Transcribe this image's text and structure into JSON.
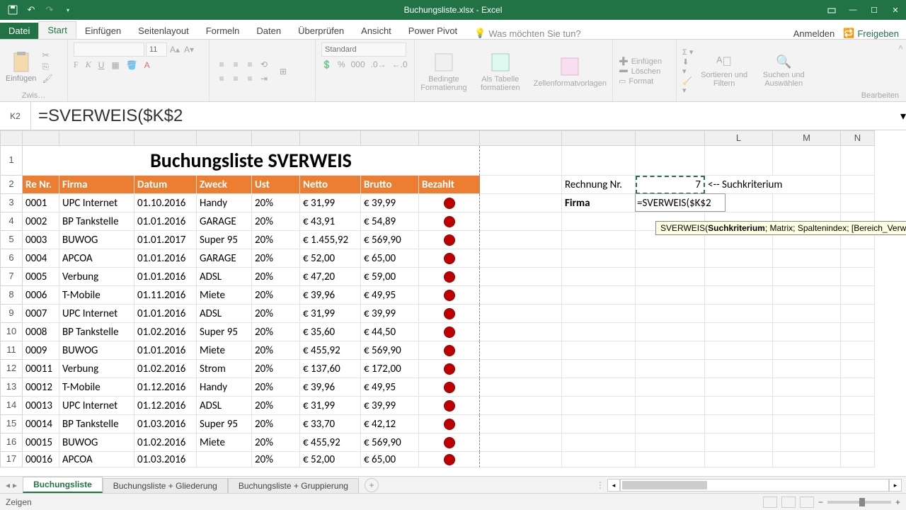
{
  "title": "Buchungsliste.xlsx - Excel",
  "tabs": {
    "file": "Datei",
    "start": "Start",
    "einfuegen": "Einfügen",
    "seitenlayout": "Seitenlayout",
    "formeln": "Formeln",
    "daten": "Daten",
    "ueberpruefen": "Überprüfen",
    "ansicht": "Ansicht",
    "powerpivot": "Power Pivot"
  },
  "tellme": "Was möchten Sie tun?",
  "login": "Anmelden",
  "share": "Freigeben",
  "ribbon": {
    "einfuegen": "Einfügen",
    "clipboard_label": "Zwis…",
    "font_size": "11",
    "number_format": "Standard",
    "bedingte": "Bedingte Formatierung",
    "alstable": "Als Tabelle formatieren",
    "cellstyles": "Zellenformatvorlagen",
    "insert": "Einfügen",
    "delete": "Löschen",
    "format": "Format",
    "sort": "Sortieren und Filtern",
    "find": "Suchen und Auswählen",
    "bearbeiten": "Bearbeiten"
  },
  "name_box": "K2",
  "formula": "=SVERWEIS($K$2",
  "col_headers_right": [
    "L",
    "M",
    "N"
  ],
  "table_title": "Buchungsliste SVERWEIS",
  "headers": [
    "Re Nr.",
    "Firma",
    "Datum",
    "Zweck",
    "Ust",
    "Netto",
    "Brutto",
    "Bezahlt"
  ],
  "rows": [
    {
      "re": "0001",
      "firma": "UPC Internet",
      "datum": "01.10.2016",
      "zweck": "Handy",
      "ust": "20%",
      "netto": "€      31,99",
      "brutto": "€ 39,99"
    },
    {
      "re": "0002",
      "firma": "BP Tankstelle",
      "datum": "01.01.2016",
      "zweck": "GARAGE",
      "ust": "20%",
      "netto": "€      43,91",
      "brutto": "€ 54,89"
    },
    {
      "re": "0003",
      "firma": "BUWOG",
      "datum": "01.01.2017",
      "zweck": "Super 95",
      "ust": "20%",
      "netto": "€ 1.455,92",
      "brutto": "€ 569,90"
    },
    {
      "re": "0004",
      "firma": "APCOA",
      "datum": "01.01.2016",
      "zweck": "GARAGE",
      "ust": "20%",
      "netto": "€      52,00",
      "brutto": "€ 65,00"
    },
    {
      "re": "0005",
      "firma": "Verbung",
      "datum": "01.01.2016",
      "zweck": "ADSL",
      "ust": "20%",
      "netto": "€      47,20",
      "brutto": "€ 59,00"
    },
    {
      "re": "0006",
      "firma": "T-Mobile",
      "datum": "01.11.2016",
      "zweck": "Miete",
      "ust": "20%",
      "netto": "€      39,96",
      "brutto": "€ 49,95"
    },
    {
      "re": "0007",
      "firma": "UPC Internet",
      "datum": "01.01.2016",
      "zweck": "ADSL",
      "ust": "20%",
      "netto": "€      31,99",
      "brutto": "€ 39,99"
    },
    {
      "re": "0008",
      "firma": "BP Tankstelle",
      "datum": "01.02.2016",
      "zweck": "Super 95",
      "ust": "20%",
      "netto": "€      35,60",
      "brutto": "€ 44,50"
    },
    {
      "re": "0009",
      "firma": "BUWOG",
      "datum": "01.01.2016",
      "zweck": "Miete",
      "ust": "20%",
      "netto": "€    455,92",
      "brutto": "€ 569,90"
    },
    {
      "re": "00011",
      "firma": "Verbung",
      "datum": "01.02.2016",
      "zweck": "Strom",
      "ust": "20%",
      "netto": "€    137,60",
      "brutto": "€ 172,00"
    },
    {
      "re": "00012",
      "firma": "T-Mobile",
      "datum": "01.12.2016",
      "zweck": "Handy",
      "ust": "20%",
      "netto": "€      39,96",
      "brutto": "€ 49,95"
    },
    {
      "re": "00013",
      "firma": "UPC Internet",
      "datum": "01.12.2016",
      "zweck": "ADSL",
      "ust": "20%",
      "netto": "€      31,99",
      "brutto": "€ 39,99"
    },
    {
      "re": "00014",
      "firma": "BP Tankstelle",
      "datum": "01.03.2016",
      "zweck": "Super 95",
      "ust": "20%",
      "netto": "€      33,70",
      "brutto": "€ 42,12"
    },
    {
      "re": "00015",
      "firma": "BUWOG",
      "datum": "01.02.2016",
      "zweck": "Miete",
      "ust": "20%",
      "netto": "€    455,92",
      "brutto": "€ 569,90"
    },
    {
      "re": "00016",
      "firma": "APCOA",
      "datum": "01.03.2016",
      "zweck": "",
      "ust": "20%",
      "netto": "€      52,00",
      "brutto": "€ 65,00"
    }
  ],
  "side": {
    "rechnung_label": "Rechnung Nr.",
    "rechnung_value": "7",
    "suchkriterium": "<-- Suchkriterium",
    "firma_label": "Firma",
    "formula_in_cell": "=SVERWEIS($K$2"
  },
  "tooltip": {
    "fn": "SVERWEIS(",
    "arg1": "Suchkriterium",
    "rest": "; Matrix; Spaltenindex; [Bereich_Verweis"
  },
  "sheets": [
    "Buchungsliste",
    "Buchungsliste + Gliederung",
    "Buchungsliste + Gruppierung"
  ],
  "status": "Zeigen"
}
